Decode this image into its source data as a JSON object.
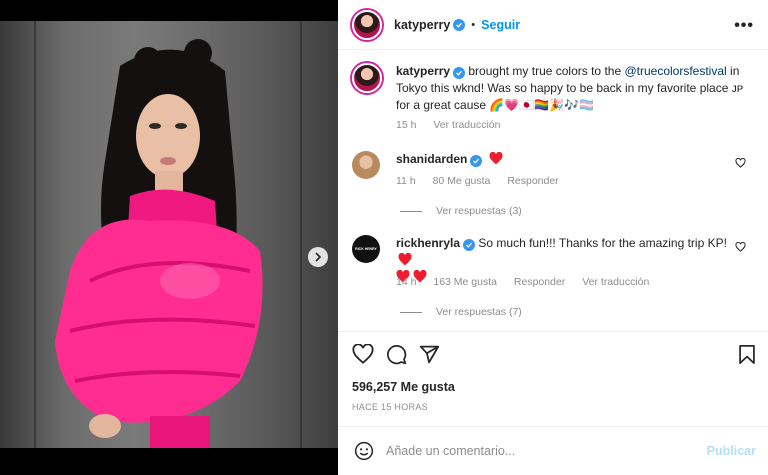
{
  "colors": {
    "accent": "#0095f6",
    "verified": "#3797f0",
    "heart": "#ed4956",
    "muted": "#8e8e8e",
    "jacket": "#ff2d8f"
  },
  "post": {
    "carousel": {
      "count": 9,
      "active_index": 0
    }
  },
  "header": {
    "username": "katyperry",
    "separator": "•",
    "follow_label": "Seguir",
    "more_label": "•••"
  },
  "caption": {
    "username": "katyperry",
    "text_before": " brought my true colors to the ",
    "mention": "@truecolorsfestival",
    "text_after": " in Tokyo this wknd! Was so happy to be back in my favorite place ᴊᴘ for a great cause 🌈💗🇯🇵🏳️‍🌈🎉🎶🏳️‍⚧️",
    "time": "15 h",
    "translate_label": "Ver traducción"
  },
  "comments": [
    {
      "username": "shanidarden",
      "text": "",
      "time": "11 h",
      "likes": "80 Me gusta",
      "reply_label": "Responder",
      "view_replies": "Ver respuestas (3)"
    },
    {
      "username": "rickhenryla",
      "text": " So much fun!!! Thanks for the amazing trip KP!",
      "time": "14 h",
      "likes": "163 Me gusta",
      "reply_label": "Responder",
      "translate_label": "Ver traducción",
      "view_replies": "Ver respuestas (7)",
      "avatar_text": "RICK HENRY"
    }
  ],
  "footer": {
    "likes": "596,257 Me gusta",
    "timestamp": "HACE 15 HORAS",
    "comment_placeholder": "Añade un comentario...",
    "publish_label": "Publicar"
  }
}
